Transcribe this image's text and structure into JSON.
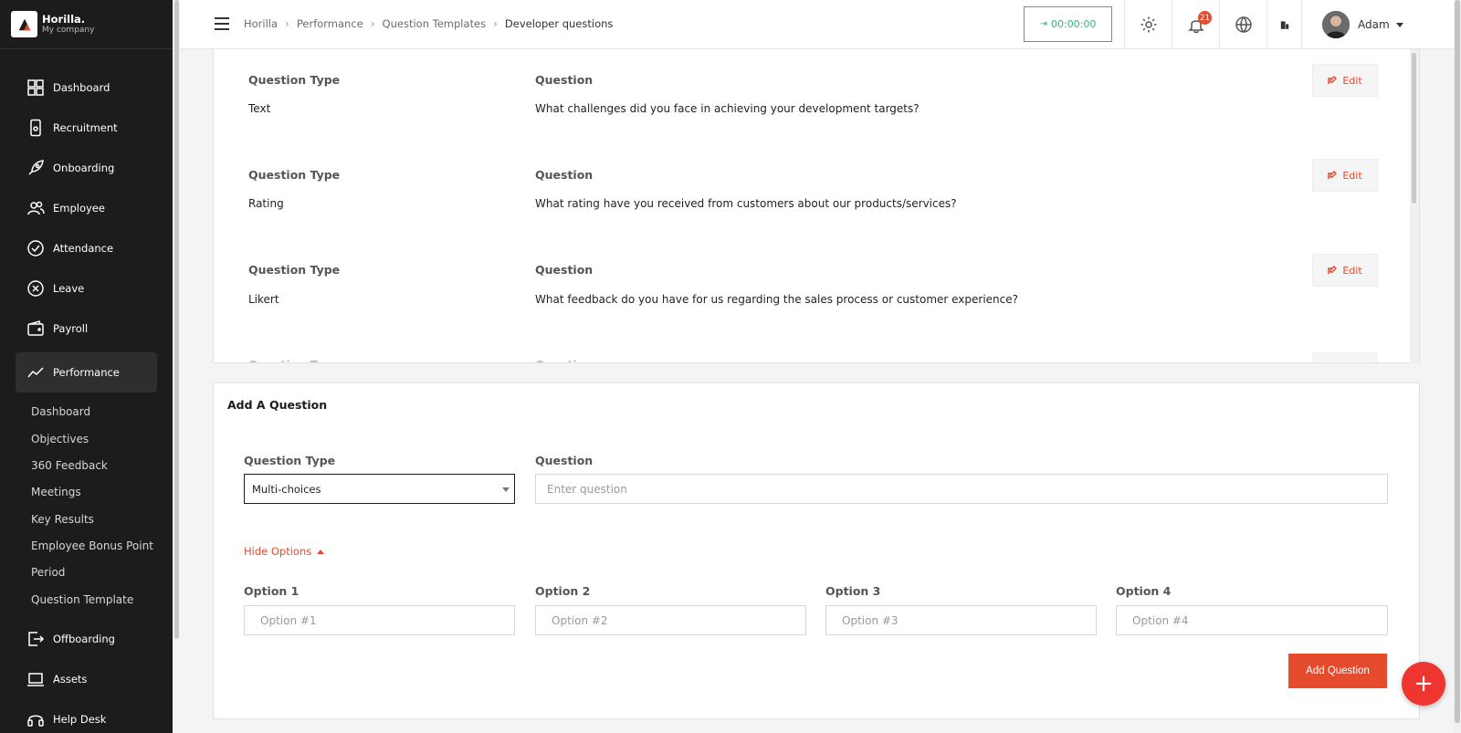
{
  "brand": {
    "name": "Horilla.",
    "company": "My company"
  },
  "sidebar": {
    "items": [
      {
        "label": "Dashboard",
        "icon": "dashboard-icon"
      },
      {
        "label": "Recruitment",
        "icon": "recruitment-icon"
      },
      {
        "label": "Onboarding",
        "icon": "rocket-icon"
      },
      {
        "label": "Employee",
        "icon": "people-icon"
      },
      {
        "label": "Attendance",
        "icon": "check-circle-icon"
      },
      {
        "label": "Leave",
        "icon": "x-circle-icon"
      },
      {
        "label": "Payroll",
        "icon": "wallet-icon"
      },
      {
        "label": "Performance",
        "icon": "trend-icon",
        "active": true
      },
      {
        "label": "Offboarding",
        "icon": "exit-icon"
      },
      {
        "label": "Assets",
        "icon": "laptop-icon"
      },
      {
        "label": "Help Desk",
        "icon": "headset-icon"
      }
    ],
    "sub_items": [
      "Dashboard",
      "Objectives",
      "360 Feedback",
      "Meetings",
      "Key Results",
      "Employee Bonus Point",
      "Period",
      "Question Template"
    ]
  },
  "header": {
    "breadcrumbs": [
      "Horilla",
      "Performance",
      "Question Templates",
      "Developer questions"
    ],
    "timer": "00:00:00",
    "notification_count": "21",
    "user_name": "Adam"
  },
  "questions": {
    "type_label": "Question Type",
    "question_label": "Question",
    "edit_label": "Edit",
    "items": [
      {
        "type": "Text",
        "question": "What challenges did you face in achieving your development targets?"
      },
      {
        "type": "Rating",
        "question": "What rating have you received from customers about our products/services?"
      },
      {
        "type": "Likert",
        "question": "What feedback do you have for us regarding the sales process or customer experience?"
      }
    ]
  },
  "add_question": {
    "title": "Add A Question",
    "type_label": "Question Type",
    "type_value": "Multi-choices",
    "question_label": "Question",
    "question_placeholder": "Enter question",
    "hide_options": "Hide Options",
    "options": [
      {
        "label": "Option 1",
        "placeholder": "Option #1"
      },
      {
        "label": "Option 2",
        "placeholder": "Option #2"
      },
      {
        "label": "Option 3",
        "placeholder": "Option #3"
      },
      {
        "label": "Option 4",
        "placeholder": "Option #4"
      }
    ],
    "submit_label": "Add Question"
  },
  "colors": {
    "accent": "#e54b2d",
    "sidebar": "#1c1c1c",
    "timer": "#3cb371",
    "fab": "#ee3530"
  }
}
